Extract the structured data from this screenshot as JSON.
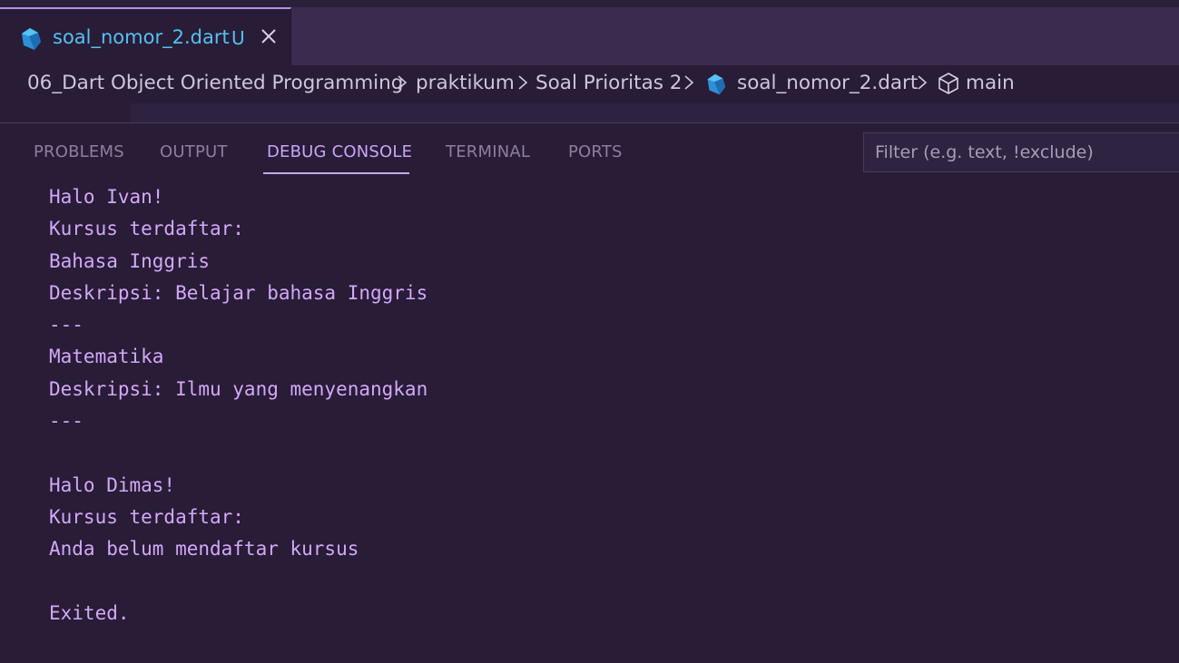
{
  "tab": {
    "filename": "soal_nomor_2.dart",
    "status": "U",
    "icon": "dart-icon"
  },
  "breadcrumb": {
    "items": [
      "06_Dart Object Oriented Programming",
      "praktikum",
      "Soal Prioritas 2",
      "soal_nomor_2.dart",
      "main"
    ]
  },
  "panel": {
    "tabs": [
      "PROBLEMS",
      "OUTPUT",
      "DEBUG CONSOLE",
      "TERMINAL",
      "PORTS"
    ],
    "active_tab": "DEBUG CONSOLE",
    "filter_placeholder": "Filter (e.g. text, !exclude)"
  },
  "console": {
    "lines": [
      "Halo Ivan!",
      "Kursus terdaftar:",
      "Bahasa Inggris",
      "Deskripsi: Belajar bahasa Inggris",
      "---",
      "Matematika",
      "Deskripsi: Ilmu yang menyenangkan",
      "---",
      "",
      "Halo Dimas!",
      "Kursus terdaftar:",
      "Anda belum mendaftar kursus",
      "",
      "Exited."
    ]
  },
  "colors": {
    "background": "#281c37",
    "accent": "#c9a6f5",
    "tab_text": "#56c0f0",
    "console_text": "#d3a8f7"
  }
}
